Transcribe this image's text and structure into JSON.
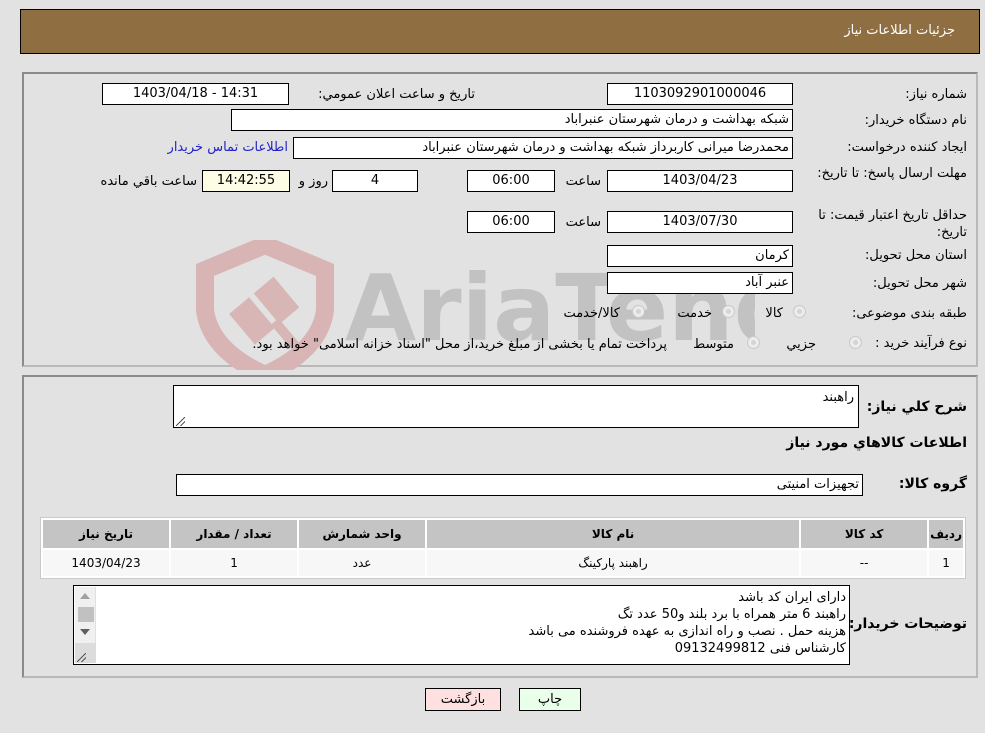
{
  "header": {
    "title": "جزئیات اطلاعات نیاز"
  },
  "details": {
    "need_number": {
      "label": "شماره نیاز:",
      "value": "1103092901000046"
    },
    "announce_datetime": {
      "label": "تاریخ و ساعت اعلان عمومي:",
      "value": "1403/04/18 - 14:31"
    },
    "buyer_org": {
      "label": "نام دستگاه خریدار:",
      "value": "شبکه بهداشت و درمان شهرستان عنبراباد"
    },
    "requester": {
      "label": "ایجاد کننده درخواست:",
      "value": "محمدرضا میرانی کاربرداز  شبکه بهداشت و درمان شهرستان عنبراباد",
      "contact_link": "اطلاعات تماس خریدار"
    },
    "reply_deadline": {
      "label": "مهلت ارسال پاسخ: تا تاریخ:",
      "date": "1403/04/23",
      "time_label": "ساعت",
      "time": "06:00",
      "days": "4",
      "days_label": "روز و",
      "remaining": "14:42:55",
      "remaining_label": "ساعت باقي مانده"
    },
    "price_validity": {
      "label": "حداقل تاریخ اعتبار قیمت: تا تاریخ:",
      "date": "1403/07/30",
      "time_label": "ساعت",
      "time": "06:00"
    },
    "delivery_province": {
      "label": "استان محل تحویل:",
      "value": "کرمان"
    },
    "delivery_city": {
      "label": "شهر محل تحویل:",
      "value": "عنبر آباد"
    },
    "category": {
      "label": "طبقه بندی موضوعی:",
      "options": [
        "کالا",
        "خدمت",
        "کالا/خدمت"
      ]
    },
    "purchase_type": {
      "label": "نوع فرآیند خرید :",
      "options": [
        "جزيي",
        "متوسط"
      ],
      "note": "پرداخت تمام یا بخشی از مبلغ خرید،از محل \"اسناد خزانه اسلامی\" خواهد بود."
    }
  },
  "description": {
    "label": "شرح کلي نياز:",
    "value": "راهبند"
  },
  "items_section": {
    "title": "اطلاعات کالاهاي مورد نياز",
    "group_label": "گروه کالا:",
    "group_value": "تجهیزات امنیتی",
    "columns": [
      "رديف",
      "کد کالا",
      "نام کالا",
      "واحد شمارش",
      "تعداد / مقدار",
      "تاريخ نياز"
    ],
    "rows": [
      [
        "1",
        "--",
        "راهبند پارکینگ",
        "عدد",
        "1",
        "1403/04/23"
      ]
    ]
  },
  "buyer_notes": {
    "label": "توضیحات خریدار:",
    "lines": [
      "دارای ایران کد باشد",
      "راهبند 6 متر همراه با برد بلند و50 عدد تگ",
      "هزینه حمل . نصب و راه اندازی به عهده فروشنده می باشد",
      "کارشناس فنی 09132499812"
    ]
  },
  "buttons": {
    "print": "چاپ",
    "back": "بازگشت"
  },
  "watermark": {
    "text": "AriaTender.neT"
  },
  "colors": {
    "header_bg": "#8f6e42",
    "print_bg": "#eaffea",
    "back_bg": "#ffe0e0",
    "link": "#2323c8"
  }
}
